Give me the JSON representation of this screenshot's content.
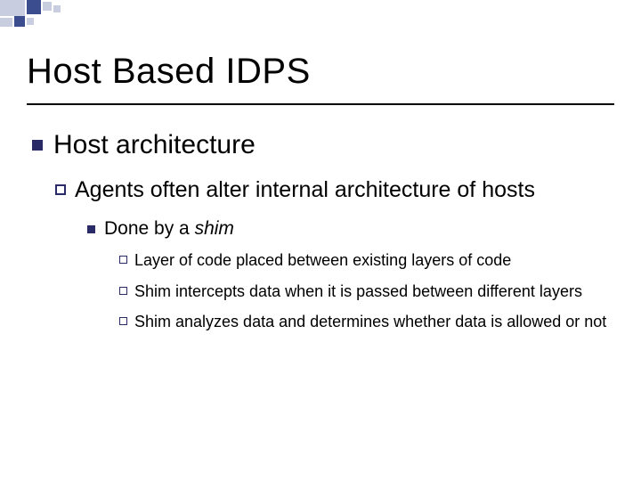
{
  "title": "Host Based IDPS",
  "lvl1": "Host architecture",
  "lvl2": "Agents often alter internal architecture of hosts",
  "lvl3_prefix": "Done by a ",
  "lvl3_italic": "shim",
  "lvl4": [
    "Layer of code placed between existing layers of code",
    "Shim intercepts data when it is passed between different layers",
    "Shim analyzes data and determines whether data is allowed or not"
  ]
}
